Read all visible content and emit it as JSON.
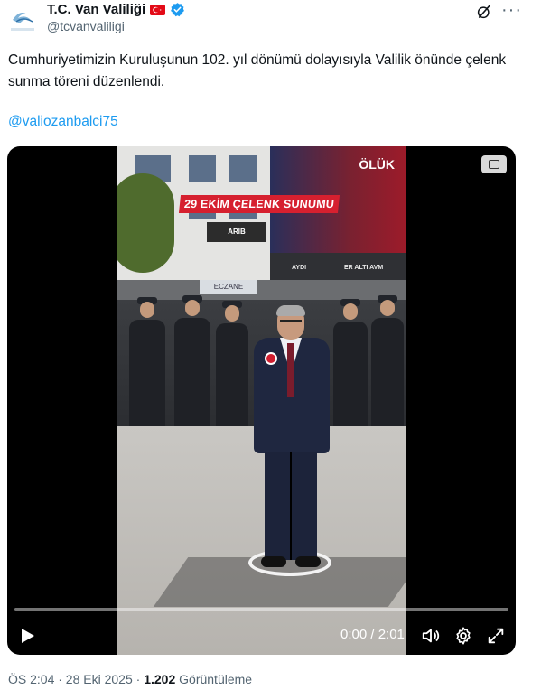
{
  "account": {
    "display_name": "T.C. Van Valiliği",
    "handle": "@tcvanvaliligi",
    "avatar_text": "VAN VALİLİĞİ"
  },
  "tweet": {
    "text": "Cumhuriyetimizin Kuruluşunun 102. yıl dönümü dolayısıyla Valilik önünde çelenk sunma töreni düzenlendi.",
    "mention": "@valiozanbalci75"
  },
  "video": {
    "caption": "29 EKİM ÇELENK SUNUMU",
    "banner_text": "ÖLÜK",
    "sign_arib": "ARIB",
    "sign_aydi": "AYDI",
    "sign_eraltı": "ER ALTI AVM",
    "sign_eczane": "ECZANE",
    "time_display": "0:00 / 2:01",
    "progress": 0.0
  },
  "footer": {
    "timestamp": "ÖS 2:04 · 28 Eki 2025 · ",
    "views_count": "1.202",
    "views_label": " Görüntüleme"
  },
  "colors": {
    "link": "#1d9bf0",
    "verified": "#1d9bf0",
    "secondary_text": "#536471",
    "flag_red": "#e30a17"
  },
  "icons": [
    "avatar-logo-icon",
    "turkish-flag-icon",
    "verified-badge-icon",
    "grok-icon",
    "more-options-icon",
    "play-icon",
    "volume-icon",
    "settings-icon",
    "fullscreen-icon"
  ]
}
